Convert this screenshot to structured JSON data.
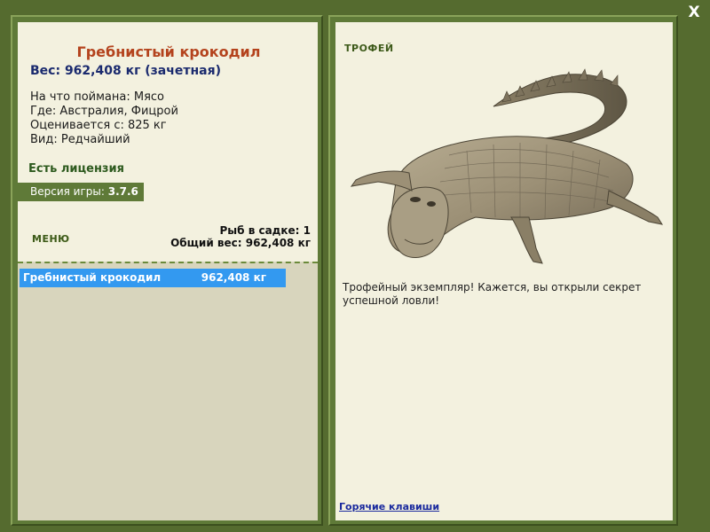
{
  "fish": {
    "title": "Гребнистый крокодил",
    "weight_line": "Вес: 962,408 кг (зачетная)",
    "caught_on": "На что поймана: Мясо",
    "location": "Где: Австралия, Фицрой",
    "valued_from": "Оценивается с: 825 кг",
    "rarity": "Вид: Редчайший"
  },
  "license": "Есть лицензия",
  "version": {
    "label": "Версия игры:",
    "value": "3.7.6"
  },
  "menu_label": "МЕНЮ",
  "cage": {
    "count_line": "Рыб в садке: 1",
    "total_weight_line": "Общий вес: 962,408 кг"
  },
  "fish_list": [
    {
      "name": "Гребнистый крокодил",
      "weight": "962,408 кг"
    }
  ],
  "trophy": {
    "label": "ТРОФЕЙ",
    "description": "Трофейный экземпляр! Кажется, вы открыли секрет успешной ловли!",
    "hotkeys_link": "Горячие клавиши"
  },
  "close_label": "X",
  "colors": {
    "background": "#556b2f",
    "panel": "#f3f1df",
    "title": "#b4431d",
    "weight": "#1a2a6e",
    "selection": "#3399f0"
  }
}
